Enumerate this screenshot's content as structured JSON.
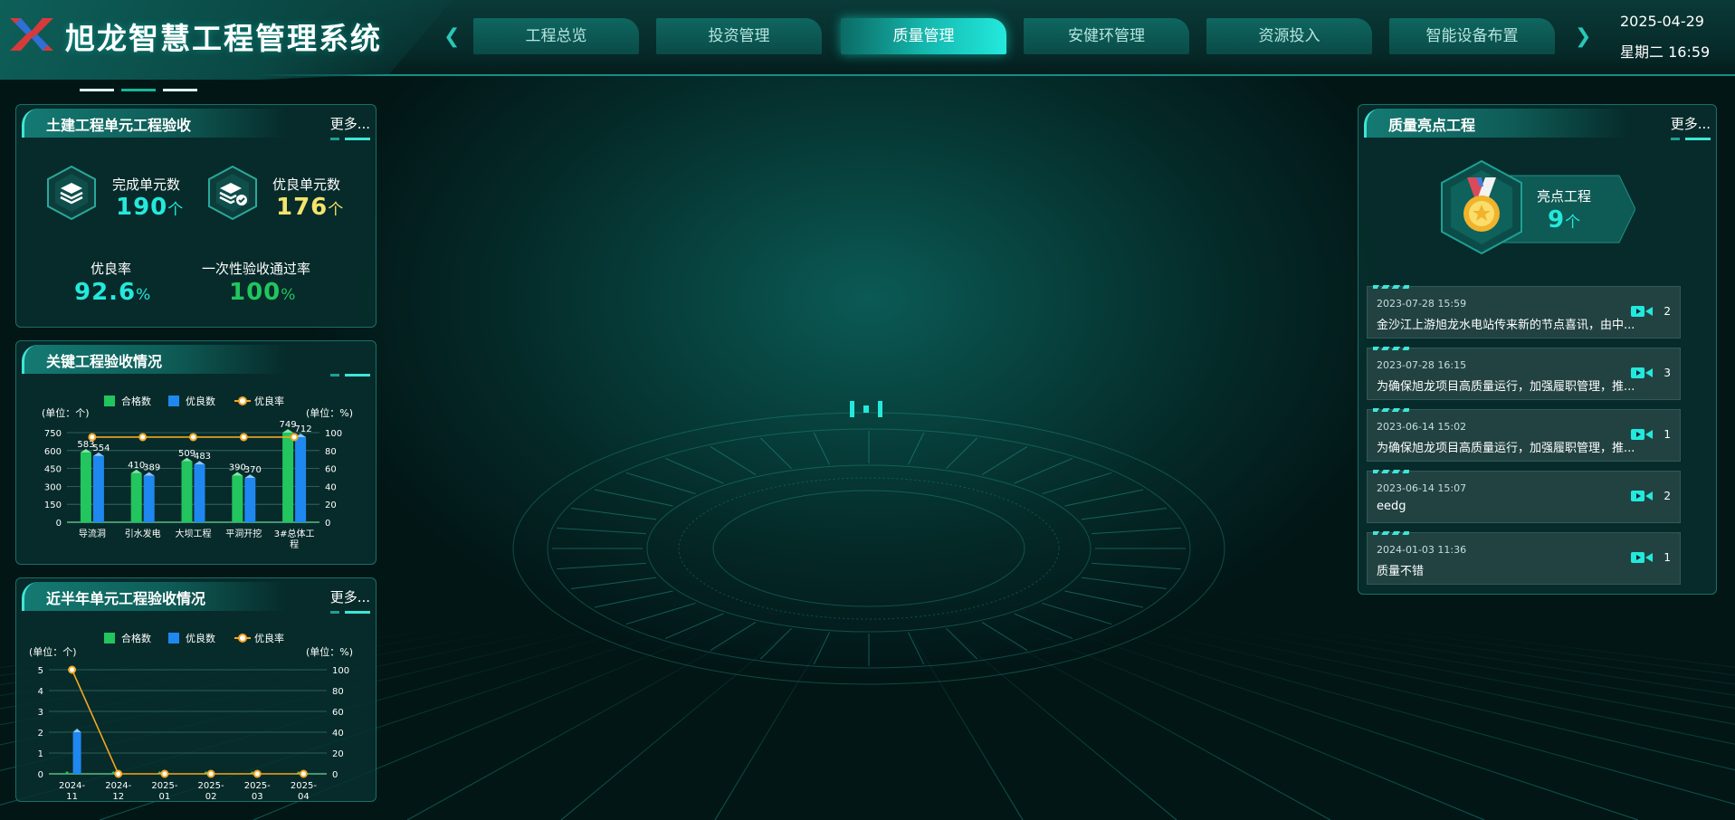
{
  "app": {
    "title": "旭龙智慧工程管理系统"
  },
  "nav": {
    "tabs": [
      {
        "label": "工程总览",
        "active": false
      },
      {
        "label": "投资管理",
        "active": false
      },
      {
        "label": "质量管理",
        "active": true
      },
      {
        "label": "安健环管理",
        "active": false
      },
      {
        "label": "资源投入",
        "active": false
      },
      {
        "label": "智能设备布置",
        "active": false
      }
    ],
    "prev_icon": "chevron-left-icon",
    "next_icon": "chevron-right-icon"
  },
  "datetime": {
    "date": "2025-04-29",
    "weekday_time": "星期二 16:59"
  },
  "civil_panel": {
    "title": "土建工程单元工程验收",
    "more": "更多...",
    "completed": {
      "label": "完成单元数",
      "value": "190",
      "unit": "个",
      "icon": "layers-icon"
    },
    "excellent": {
      "label": "优良单元数",
      "value": "176",
      "unit": "个",
      "icon": "layers-check-icon"
    },
    "excellent_rate": {
      "label": "优良率",
      "value": "92.6",
      "unit": "%"
    },
    "first_pass_rate": {
      "label": "一次性验收通过率",
      "value": "100",
      "unit": "%"
    }
  },
  "key_panel": {
    "title": "关键工程验收情况",
    "legend": [
      "合格数",
      "优良数",
      "优良率"
    ],
    "y_left_unit": "(单位：个)",
    "y_right_unit": "(单位：%)"
  },
  "recent_panel": {
    "title": "近半年单元工程验收情况",
    "more": "更多...",
    "legend": [
      "合格数",
      "优良数",
      "优良率"
    ],
    "y_left_unit": "(单位：个)",
    "y_right_unit": "(单位：%)"
  },
  "highlight_panel": {
    "title": "质量亮点工程",
    "more": "更多...",
    "badge_label": "亮点工程",
    "badge_value": "9",
    "badge_unit": "个",
    "badge_icon": "medal-icon",
    "items": [
      {
        "date": "2023-07-28 15:59",
        "text": "金沙江上游旭龙水电站传来新的节点喜讯，由中...",
        "count": "2"
      },
      {
        "date": "2023-07-28 16:15",
        "text": "为确保旭龙项目高质量运行，加强履职管理，推...",
        "count": "3"
      },
      {
        "date": "2023-06-14 15:02",
        "text": "为确保旭龙项目高质量运行，加强履职管理，推...",
        "count": "1"
      },
      {
        "date": "2023-06-14 15:07",
        "text": "eedg",
        "count": "2"
      },
      {
        "date": "2024-01-03 11:36",
        "text": "质量不错",
        "count": "1"
      }
    ]
  },
  "colors": {
    "accent": "#23e9dc",
    "green": "#22c55e",
    "blue": "#1e88f0",
    "orange": "#f5a623",
    "yellow": "#f3e36b"
  },
  "chart_data": [
    {
      "type": "bar",
      "title": "关键工程验收情况",
      "categories": [
        "导流洞",
        "引水发电",
        "大坝工程",
        "平洞开挖",
        "3#总体工程"
      ],
      "series": [
        {
          "name": "合格数",
          "values": [
            583,
            410,
            509,
            390,
            749
          ]
        },
        {
          "name": "优良数",
          "values": [
            554,
            389,
            483,
            370,
            712
          ]
        },
        {
          "name": "优良率",
          "values": [
            95,
            95,
            95,
            95,
            95
          ]
        }
      ],
      "ylim_left": [
        0,
        750
      ],
      "yticks_left": [
        0,
        150,
        300,
        450,
        600,
        750
      ],
      "ylim_right": [
        0,
        100
      ],
      "yticks_right": [
        0,
        20,
        40,
        60,
        80,
        100
      ]
    },
    {
      "type": "bar",
      "title": "近半年单元工程验收情况",
      "categories": [
        "2024-11",
        "2024-12",
        "2025-01",
        "2025-02",
        "2025-03",
        "2025-04"
      ],
      "series": [
        {
          "name": "合格数",
          "values": [
            0,
            0,
            0,
            0,
            0,
            0
          ]
        },
        {
          "name": "优良数",
          "values": [
            2,
            0,
            0,
            0,
            0,
            0
          ]
        },
        {
          "name": "优良率",
          "values": [
            100,
            0,
            0,
            0,
            0,
            0
          ]
        }
      ],
      "ylim_left": [
        0,
        5
      ],
      "yticks_left": [
        0,
        1,
        2,
        3,
        4,
        5
      ],
      "ylim_right": [
        0,
        100
      ],
      "yticks_right": [
        0,
        20,
        40,
        60,
        80,
        100
      ]
    }
  ]
}
